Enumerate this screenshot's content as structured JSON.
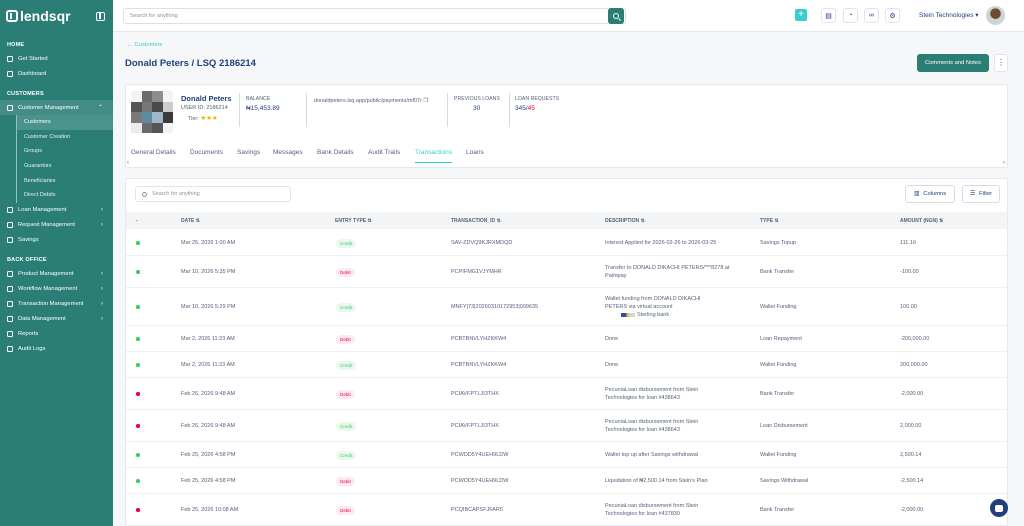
{
  "brand": {
    "name": "lendsqr"
  },
  "sidebar": {
    "sections": {
      "home": "HOME",
      "customers": "CUSTOMERS",
      "back_office": "BACK OFFICE"
    },
    "home_items": [
      "Get Started",
      "Dashboard"
    ],
    "customer_management": "Customer Management",
    "customer_sub_items": [
      "Customers",
      "Customer Creation",
      "Groups",
      "Guarantors",
      "Beneficiaries",
      "Direct Debits"
    ],
    "customer_items": [
      "Loan Management",
      "Request Management",
      "Savings"
    ],
    "back_office_items": [
      "Product Management",
      "Workflow Management",
      "Transaction Management",
      "Data Management",
      "Reports",
      "Audit Logs"
    ]
  },
  "topbar": {
    "search_placeholder": "Search for anything",
    "org_name": "Stein Technologies"
  },
  "page": {
    "back_label": "Customers",
    "title": "Donald Peters / LSQ 2186214",
    "comments_button": "Comments and Notes"
  },
  "profile": {
    "name": "Donald Peters",
    "user_id": "USER ID: 2186214",
    "tier_label": "Tier:",
    "tier_stars": "★★★",
    "balance_label": "BALANCE",
    "balance_value": "₦15,453.89",
    "payment_link": "donaldpeters.lsq.app/public/payments/mf07r",
    "previous_loans_label": "PREVIOUS LOANS",
    "previous_loans_value": "30",
    "loan_requests_label": "LOAN REQUESTS",
    "loan_requests_value": "345",
    "loan_requests_total": "45"
  },
  "tabs": [
    "General Details",
    "Documents",
    "Savings",
    "Messages",
    "Bank Details",
    "Audit Trails",
    "Transactions",
    "Loans"
  ],
  "active_tab": "Transactions",
  "table": {
    "search_placeholder": "Search for anything",
    "columns_button": "Columns",
    "filter_button": "Filter",
    "headers": [
      "DATE",
      "ENTRY TYPE",
      "TRANSACTION_ID",
      "DESCRIPTION",
      "TYPE",
      "AMOUNT (NGN)"
    ],
    "rows": [
      {
        "status": "green",
        "date": "Mar 25, 2026 1:00 AM",
        "entry": "Credit",
        "id": "SAV-ZDVQ9KJRXMDQD",
        "desc": "Interest Applied for 2026-02-26 to 2026-03-25",
        "desc2": "",
        "desc3": "",
        "type": "Savings Topup",
        "amount": "111.16"
      },
      {
        "status": "green",
        "date": "Mar 10, 2026 5:35 PM",
        "entry": "Debit",
        "id": "PCPIFMG1VJYMHR",
        "desc": "Transfer to DONALD DIKACHI PETERS/***8278 at",
        "desc2": "Palmpay",
        "desc3": "",
        "type": "Bank Transfer",
        "amount": "-100.00"
      },
      {
        "status": "green",
        "date": "Mar 10, 2026 5:29 PM",
        "entry": "Credit",
        "id": "MNFY|73|20260310172953|009635",
        "desc": "Wallet funding from DONALD DIKACHI",
        "desc2": "PETERS via virtual account",
        "desc3": "Sterling bank",
        "type": "Wallet Funding",
        "amount": "100.00"
      },
      {
        "status": "green",
        "date": "Mar 2, 2026 11:23 AM",
        "entry": "Debit",
        "id": "PCBTBNVLYHZKKW4",
        "desc": "Done",
        "desc2": "",
        "desc3": "",
        "type": "Loan Repayment",
        "amount": "-200,000.00"
      },
      {
        "status": "green",
        "date": "Mar 2, 2026 11:23 AM",
        "entry": "Credit",
        "id": "PCBTBNVLYHZKKW4",
        "desc": "Done",
        "desc2": "",
        "desc3": "",
        "type": "Wallet Funding",
        "amount": "200,000.00"
      },
      {
        "status": "red",
        "date": "Feb 26, 2026 9:48 AM",
        "entry": "Debit",
        "id": "PCIAVFPTLJI3THX",
        "desc": "PecuniaLoan disbursement from Stein",
        "desc2": "Technologies for loan #438643",
        "desc3": "",
        "type": "Bank Transfer",
        "amount": "-2,000.00"
      },
      {
        "status": "red",
        "date": "Feb 26, 2026 9:48 AM",
        "entry": "Credit",
        "id": "PCIAVFPTLJI3THX",
        "desc": "PecuniaLoan disbursement from Stein",
        "desc2": "Technologies for loan #438643",
        "desc3": "",
        "type": "Loan Disbursement",
        "amount": "2,000.00"
      },
      {
        "status": "green",
        "date": "Feb 25, 2026 4:58 PM",
        "entry": "Credit",
        "id": "PCWDD5Y4UEH9LDW",
        "desc": "Wallet top up after Savings withdrawal",
        "desc2": "",
        "desc3": "",
        "type": "Wallet Funding",
        "amount": "2,500.14"
      },
      {
        "status": "green",
        "date": "Feb 25, 2026 4:58 PM",
        "entry": "Debit",
        "id": "PCWDD5Y4UEH9LDW",
        "desc": "Liquidation of ₦2,500.14 from Stein's Plan",
        "desc2": "",
        "desc3": "",
        "type": "Savings Withdrawal",
        "amount": "-2,500.14"
      },
      {
        "status": "red",
        "date": "Feb 25, 2026 10:08 AM",
        "entry": "Debit",
        "id": "PCQIBCAPSFJFAR5",
        "desc": "PecuniaLoan disbursement from Stein",
        "desc2": "Technologies for loan #437830",
        "desc3": "",
        "type": "Bank Transfer",
        "amount": "-2,000.00"
      }
    ]
  },
  "colors": {
    "sidebar": "#2a7e76",
    "accent": "#39cdcc",
    "primary_text": "#213f7d",
    "credit": "#39cd62",
    "debit": "#e4033b"
  }
}
